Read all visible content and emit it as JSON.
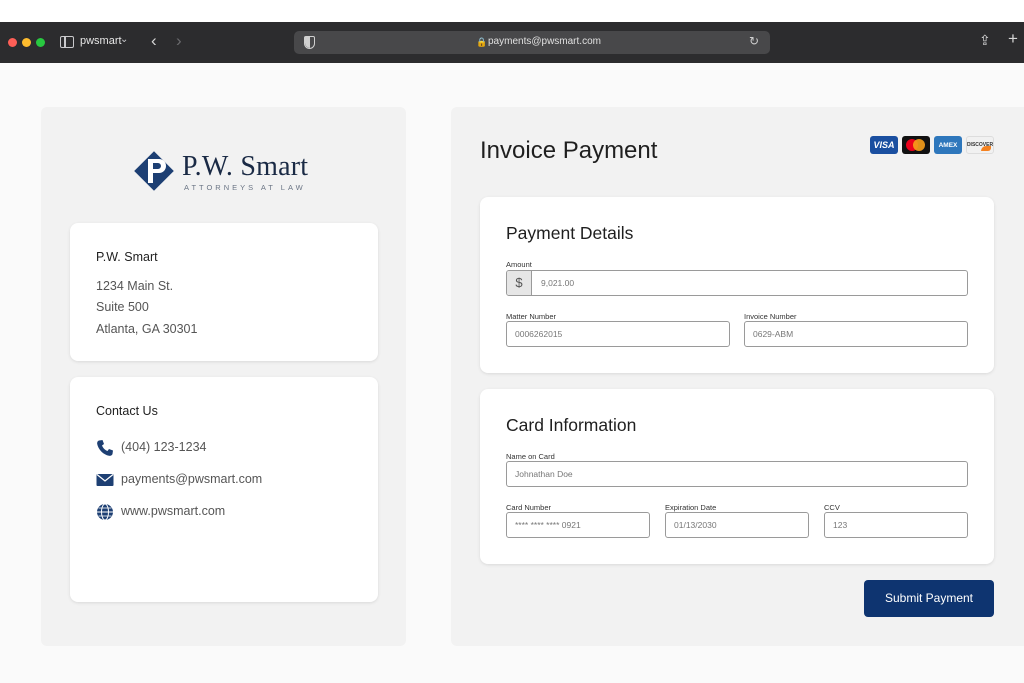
{
  "browser": {
    "tab_name": "pwsmart",
    "url": "payments@pwsmart.com"
  },
  "left": {
    "logo": {
      "name": "P.W. Smart",
      "tagline": "ATTORNEYS AT LAW",
      "brand_color": "#0e3470"
    },
    "address": {
      "title": "P.W. Smart",
      "lines": [
        "1234 Main St.",
        "Suite 500",
        "Atlanta, GA 30301"
      ]
    },
    "contact": {
      "title": "Contact Us",
      "phone": "(404) 123-1234",
      "email": "payments@pwsmart.com",
      "website": "www.pwsmart.com"
    }
  },
  "right": {
    "title": "Invoice Payment",
    "card_logos": [
      "VISA",
      "mastercard",
      "AMEX",
      "DISCOVER"
    ],
    "payment_details": {
      "title": "Payment Details",
      "amount_label": "Amount",
      "currency_symbol": "$",
      "amount_value": "9,021.00",
      "matter_label": "Matter Number",
      "matter_value": "0006262015",
      "invoice_label": "Invoice Number",
      "invoice_value": "0629-ABM"
    },
    "card_information": {
      "title": "Card Information",
      "name_label": "Name on Card",
      "name_value": "Johnathan Doe",
      "card_number_label": "Card Number",
      "card_number_value": "**** **** **** 0921",
      "expiration_label": "Expiration Date",
      "expiration_value": "01/13/2030",
      "ccv_label": "CCV",
      "ccv_value": "123"
    },
    "submit_label": "Submit Payment",
    "submit_color": "#0e3470"
  }
}
